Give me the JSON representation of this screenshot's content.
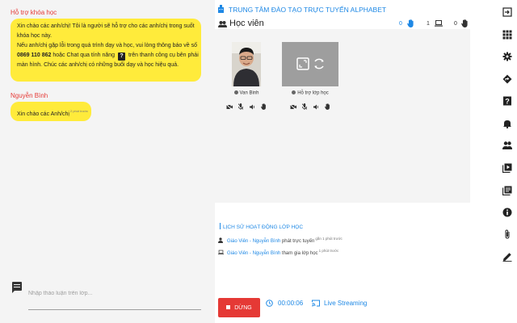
{
  "chat": {
    "messages": [
      {
        "sender": "Hỗ trợ khóa học",
        "lines": [
          "Xin chào các anh/chị! Tôi là người sẽ hỗ trợ cho các anh/chị trong suốt",
          "khóa học này.",
          "Nếu anh/chị gặp lỗi trong quá trình dạy và học, vui lòng thông báo về số",
          "0869 110 862",
          " hoặc Chat qua tính năng",
          " trên thanh công cụ bên phải",
          "màn hình. Chúc các anh/chị có những buổi dạy và học hiệu quả."
        ],
        "help_icon_glyph": "?"
      },
      {
        "sender": "Nguyễn Bình",
        "text": "Xin chào các Anh/chị",
        "time": "2 phút trước"
      }
    ],
    "input_placeholder": "Nhập thảo luận trên lớp..."
  },
  "header": {
    "center_name": "TRUNG TÂM ĐÀO TẠO TRỰC TUYẾN ALPHABET",
    "section_title": "Học viên",
    "raised_hands": "0",
    "devices": "1",
    "other_count": "0"
  },
  "participants": [
    {
      "name": "Van Binh"
    },
    {
      "name": "Hỗ trợ lớp học"
    }
  ],
  "history": {
    "title": "LỊCH SỬ HOẠT ĐỘNG LỚP HỌC",
    "items": [
      {
        "actor": "Giáo Viên - Nguyễn Bình",
        "action": " phát trực tuyến",
        "time": "gần 1 phút trước"
      },
      {
        "actor": "Giáo Viên - Nguyễn Bình",
        "action": " tham gia lớp học",
        "time": "1 phút trước"
      }
    ]
  },
  "controls": {
    "stop_label": "DỪNG",
    "timer": "00:00:06",
    "live_label": "Live Streaming"
  },
  "toolbar_icons": [
    "exit-icon",
    "apps-grid-icon",
    "settings-icon",
    "directions-icon",
    "help-icon",
    "bell-icon",
    "people-icon",
    "video-library-icon",
    "notes-icon",
    "info-icon",
    "attachment-icon",
    "edit-icon"
  ],
  "colors": {
    "accent": "#1e88e5",
    "bubble": "#ffeb3b",
    "sender": "#e53935",
    "stop": "#e53935"
  }
}
